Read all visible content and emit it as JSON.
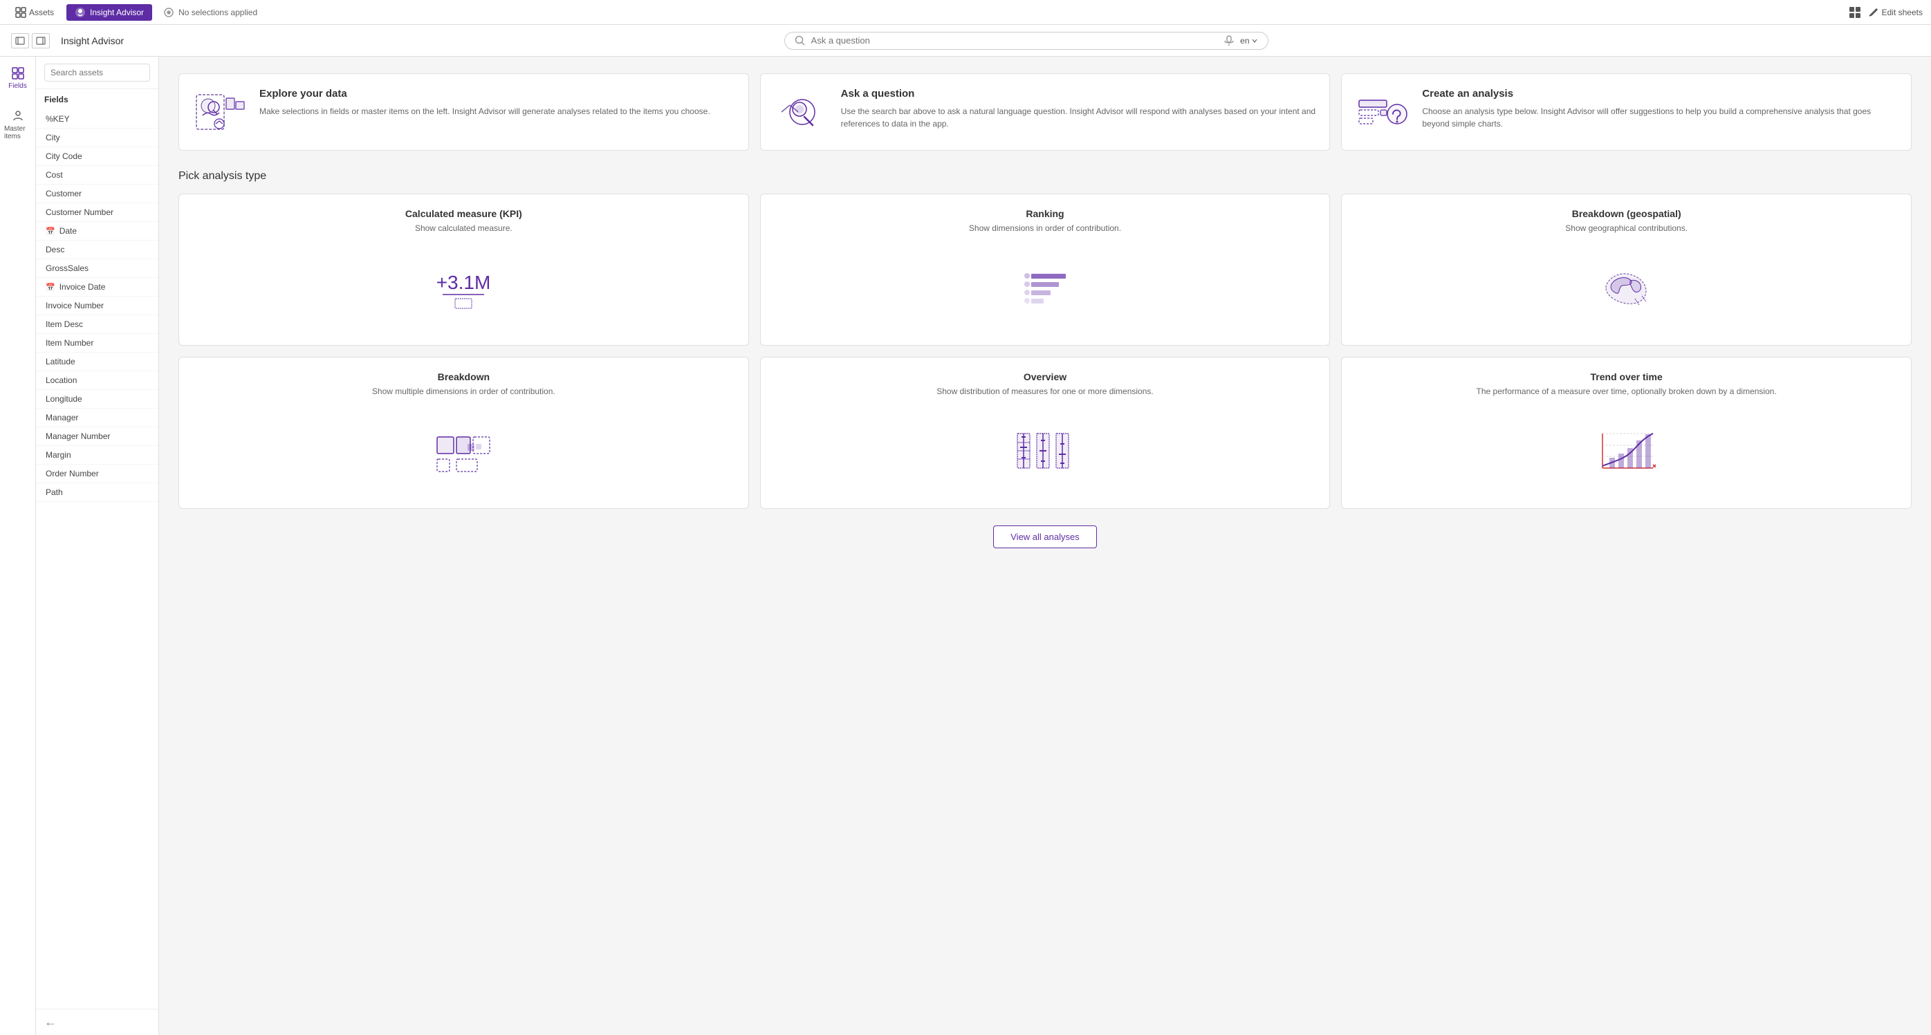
{
  "topNav": {
    "assetsLabel": "Assets",
    "insightLabel": "Insight Advisor",
    "selectionsLabel": "No selections applied",
    "editSheetsLabel": "Edit sheets",
    "langLabel": "en"
  },
  "secondBar": {
    "title": "Insight Advisor",
    "searchPlaceholder": "Ask a question"
  },
  "sidebar": {
    "searchPlaceholder": "Search assets",
    "fieldsLabel": "Fields",
    "masterItemsLabel": "Master items",
    "items": [
      {
        "label": "%KEY",
        "icon": ""
      },
      {
        "label": "City",
        "icon": ""
      },
      {
        "label": "City Code",
        "icon": ""
      },
      {
        "label": "Cost",
        "icon": ""
      },
      {
        "label": "Customer",
        "icon": ""
      },
      {
        "label": "Customer Number",
        "icon": ""
      },
      {
        "label": "Date",
        "icon": "calendar"
      },
      {
        "label": "Desc",
        "icon": ""
      },
      {
        "label": "GrossSales",
        "icon": ""
      },
      {
        "label": "Invoice Date",
        "icon": "calendar"
      },
      {
        "label": "Invoice Number",
        "icon": ""
      },
      {
        "label": "Item Desc",
        "icon": ""
      },
      {
        "label": "Item Number",
        "icon": ""
      },
      {
        "label": "Latitude",
        "icon": ""
      },
      {
        "label": "Location",
        "icon": ""
      },
      {
        "label": "Longitude",
        "icon": ""
      },
      {
        "label": "Manager",
        "icon": ""
      },
      {
        "label": "Manager Number",
        "icon": ""
      },
      {
        "label": "Margin",
        "icon": ""
      },
      {
        "label": "Order Number",
        "icon": ""
      },
      {
        "label": "Path",
        "icon": ""
      }
    ]
  },
  "introCards": [
    {
      "id": "explore",
      "title": "Explore your data",
      "description": "Make selections in fields or master items on the left. Insight Advisor will generate analyses related to the items you choose."
    },
    {
      "id": "ask",
      "title": "Ask a question",
      "description": "Use the search bar above to ask a natural language question. Insight Advisor will respond with analyses based on your intent and references to data in the app."
    },
    {
      "id": "create",
      "title": "Create an analysis",
      "description": "Choose an analysis type below. Insight Advisor will offer suggestions to help you build a comprehensive analysis that goes beyond simple charts."
    }
  ],
  "pickAnalysisTitle": "Pick analysis type",
  "analysisTypes": [
    {
      "id": "kpi",
      "title": "Calculated measure (KPI)",
      "description": "Show calculated measure.",
      "illustrationType": "kpi"
    },
    {
      "id": "ranking",
      "title": "Ranking",
      "description": "Show dimensions in order of contribution.",
      "illustrationType": "ranking"
    },
    {
      "id": "geospatial",
      "title": "Breakdown (geospatial)",
      "description": "Show geographical contributions.",
      "illustrationType": "geo"
    },
    {
      "id": "breakdown",
      "title": "Breakdown",
      "description": "Show multiple dimensions in order of contribution.",
      "illustrationType": "breakdown"
    },
    {
      "id": "overview",
      "title": "Overview",
      "description": "Show distribution of measures for one or more dimensions.",
      "illustrationType": "overview"
    },
    {
      "id": "trend",
      "title": "Trend over time",
      "description": "The performance of a measure over time, optionally broken down by a dimension.",
      "illustrationType": "trend"
    }
  ],
  "viewAllLabel": "View all analyses"
}
